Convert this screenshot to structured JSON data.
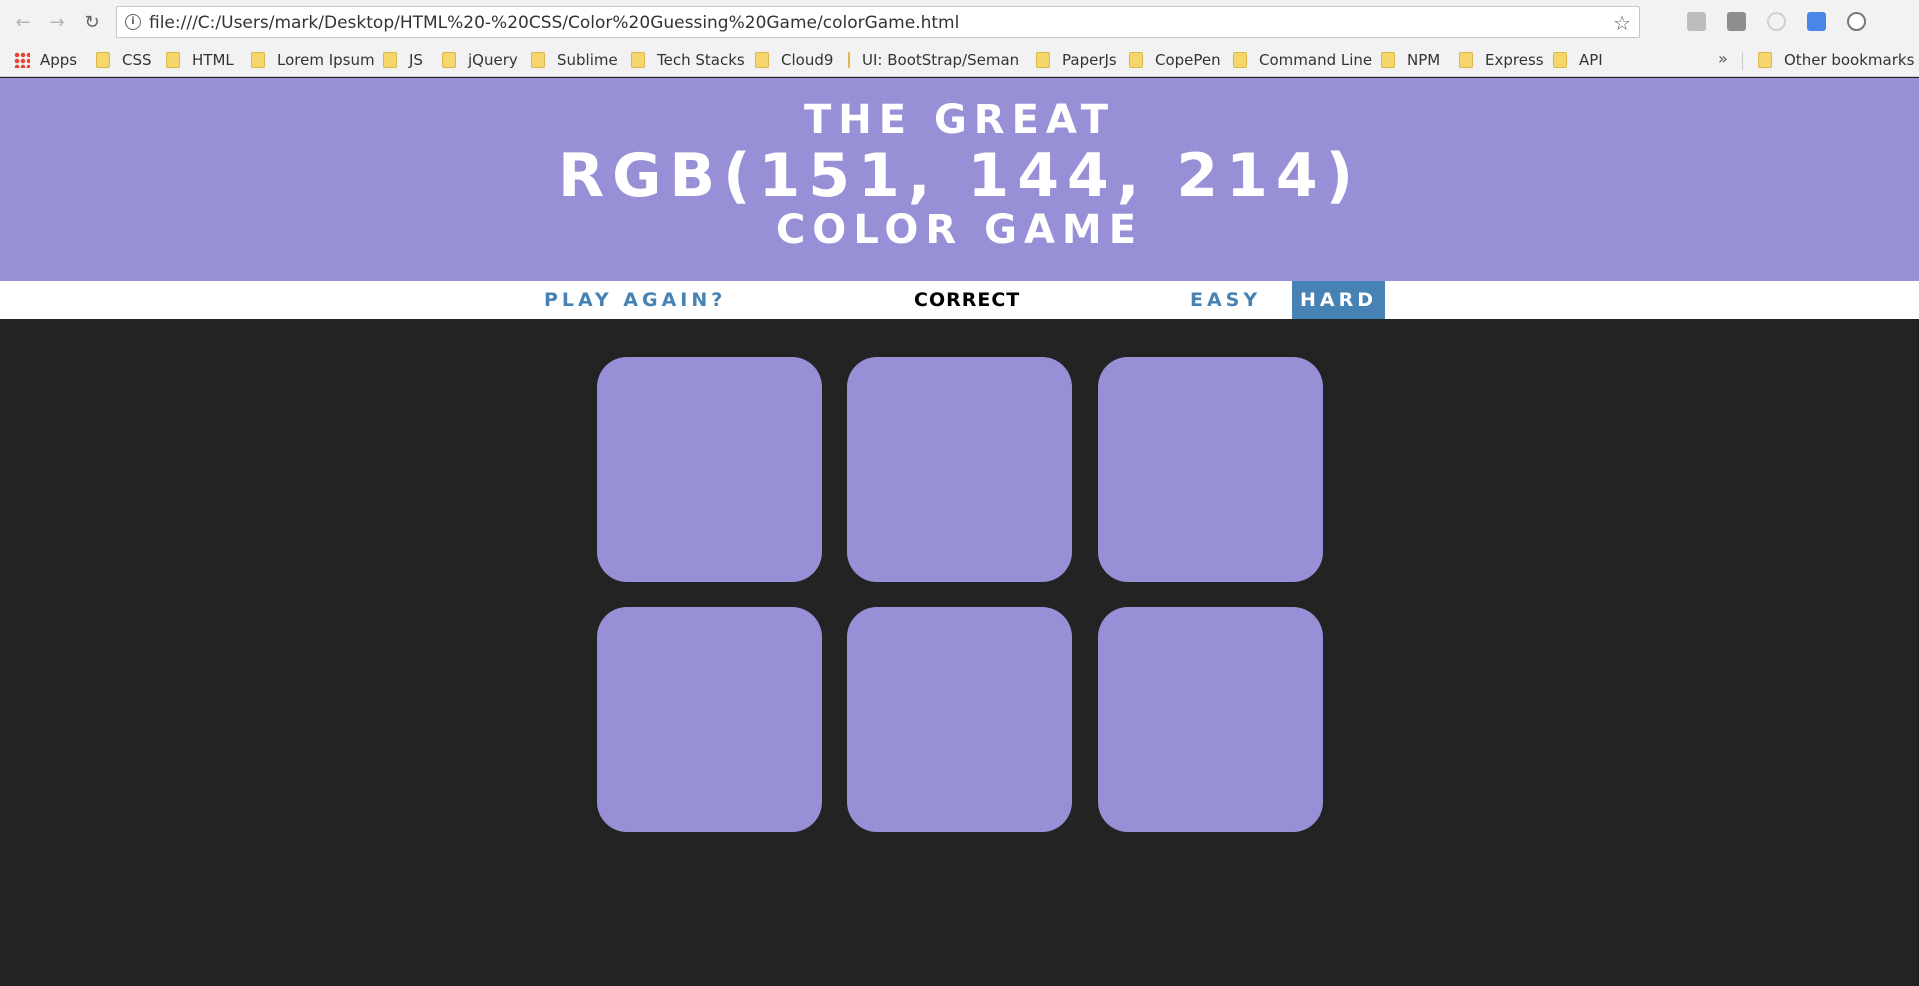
{
  "browser": {
    "url": "file:///C:/Users/mark/Desktop/HTML%20-%20CSS/Color%20Guessing%20Game/colorGame.html",
    "bookmarks": [
      "Apps",
      "CSS",
      "HTML",
      "Lorem Ipsum",
      "JS",
      "jQuery",
      "Sublime",
      "Tech Stacks",
      "Cloud9",
      "UI: BootStrap/Semant",
      "PaperJs",
      "CopePen",
      "Command Line",
      "NPM",
      "Express",
      "API"
    ],
    "more_label": "»",
    "other_bookmarks": "Other bookmarks"
  },
  "game": {
    "title_top": "The Great",
    "rgb_display": "RGB(151, 144, 214)",
    "title_bottom": "Color Game",
    "header_color": "#9790d6",
    "play_again_label": "Play Again?",
    "message": "Correct",
    "easy_label": "Easy",
    "hard_label": "Hard",
    "selected_mode": "Hard",
    "squares": [
      "#9790d6",
      "#9790d6",
      "#9790d6",
      "#9790d6",
      "#9790d6",
      "#9790d6"
    ]
  },
  "icons": [
    "back-icon",
    "forward-icon",
    "reload-icon",
    "info-icon",
    "star-icon",
    "apps-icon",
    "folder-icon"
  ]
}
